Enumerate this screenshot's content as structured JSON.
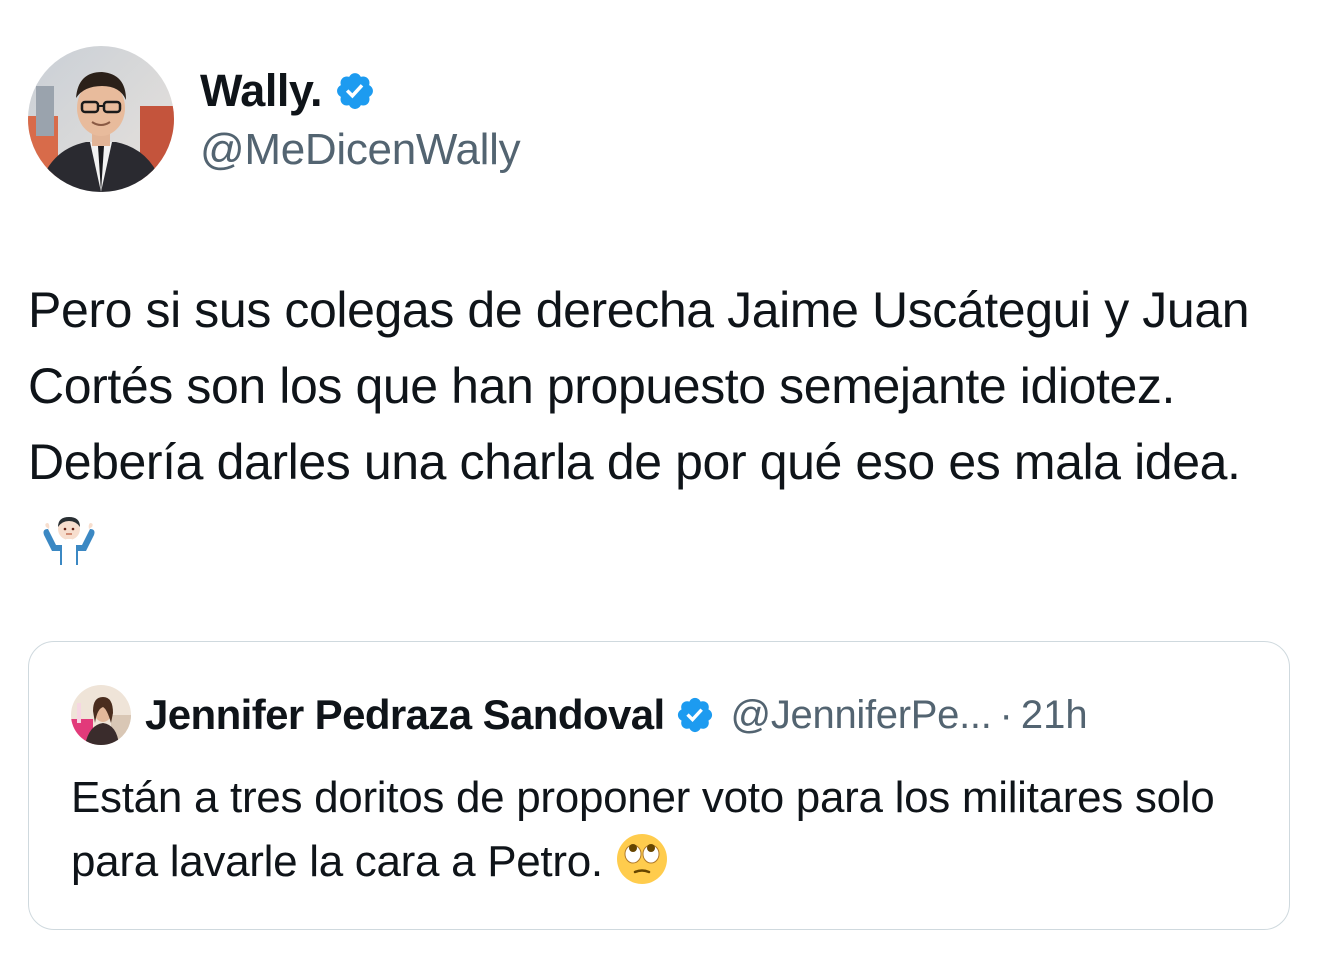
{
  "tweet": {
    "author_name": "Wally.",
    "author_handle": "@MeDicenWally",
    "verified": true,
    "text": "Pero si sus colegas de derecha Jaime Uscátegui y Juan Cortés son los que han propuesto semejante idiotez. Debería darles una charla de por qué eso es mala idea.",
    "emoji_icon": "person-shrugging-emoji"
  },
  "quoted_tweet": {
    "author_name": "Jennifer Pedraza Sandoval",
    "author_handle": "@JenniferPe...",
    "separator": "·",
    "time": "21h",
    "verified": true,
    "text": "Están a tres doritos de proponer voto para los militares solo para lavarle la cara a Petro.",
    "emoji_icon": "face-with-rolling-eyes-emoji"
  },
  "colors": {
    "verified_blue": "#1d9bf0",
    "text_primary": "#0f1419",
    "text_secondary": "#536471",
    "border": "#cfd9de"
  }
}
